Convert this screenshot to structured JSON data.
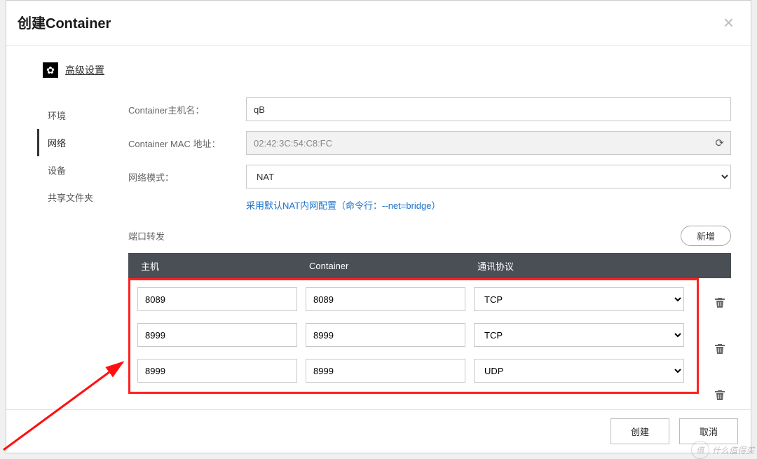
{
  "modal": {
    "title": "创建Container",
    "advanced_label": "高级设置"
  },
  "menu": {
    "items": [
      "环境",
      "网络",
      "设备",
      "共享文件夹"
    ],
    "active_index": 1
  },
  "form": {
    "hostname_label": "Container主机名：",
    "hostname_value": "qB",
    "mac_label": "Container MAC 地址：",
    "mac_value": "02:42:3C:54:C8:FC",
    "netmode_label": "网络模式：",
    "netmode_value": "NAT",
    "hint_text": "采用默认NAT内网配置（命令行：--net=bridge）"
  },
  "ports": {
    "section_label": "端口转发",
    "add_label": "新增",
    "headers": {
      "host": "主机",
      "container": "Container",
      "protocol": "通讯协议"
    },
    "rows": [
      {
        "host": "8089",
        "container": "8089",
        "protocol": "TCP"
      },
      {
        "host": "8999",
        "container": "8999",
        "protocol": "TCP"
      },
      {
        "host": "8999",
        "container": "8999",
        "protocol": "UDP"
      }
    ]
  },
  "footer": {
    "create": "创建",
    "cancel": "取消"
  },
  "watermark": "什么值得买"
}
